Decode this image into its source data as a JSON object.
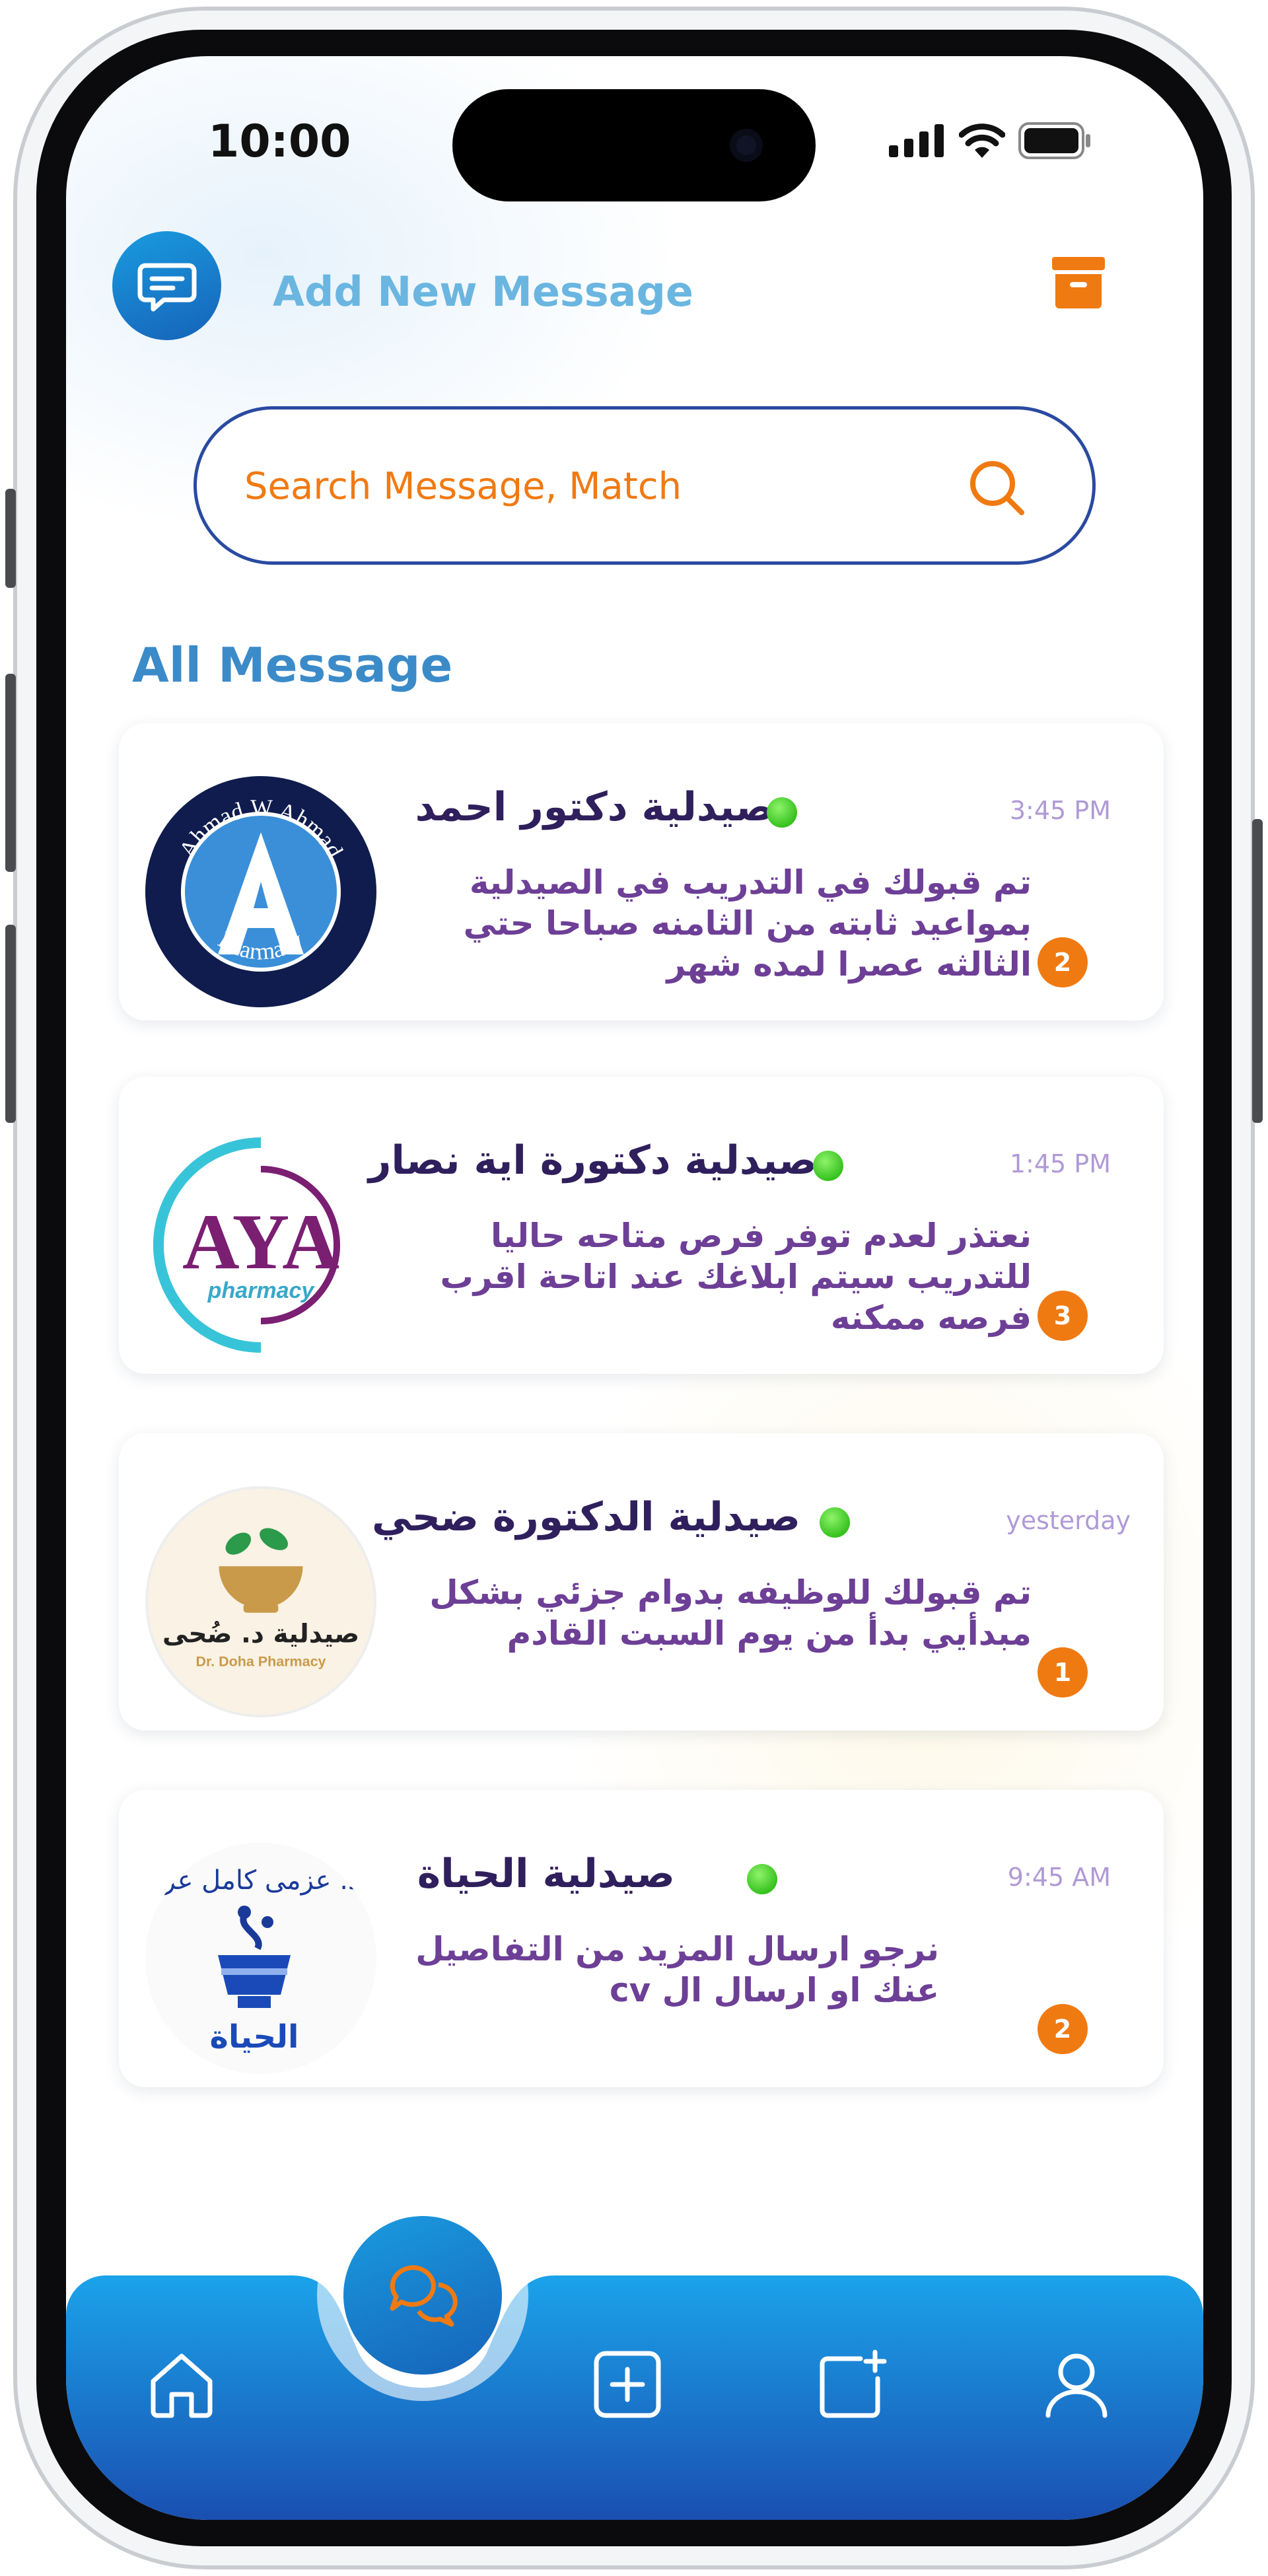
{
  "status_bar": {
    "time": "10:00"
  },
  "header": {
    "title": "Add New Message"
  },
  "search": {
    "placeholder": "Search Message, Match"
  },
  "section_title": "All Message",
  "conversations": [
    {
      "name": "صيدلية دكتور احمد",
      "time": "3:45 PM",
      "preview": "تم قبولك في التدريب في الصيدلية  بمواعيد ثابته من الثامنه صباحا حتي الثالثه عصرا لمده شهر",
      "unread": "2",
      "avatar_text": [
        "Ahmad W Ahmad",
        "A",
        "Pharmacy"
      ]
    },
    {
      "name": "صيدلية دكتورة اية نصار",
      "time": "1:45 PM",
      "preview": "نعتذر لعدم توفر فرص متاحه حاليا للتدريب سيتم ابلاغك عند اتاحة اقرب فرصه ممكنه",
      "unread": "3",
      "avatar_text": [
        "AYA",
        "pharmacy"
      ]
    },
    {
      "name": "صيدلية الدكتورة ضحي",
      "time": "yesterday",
      "preview": "تم قبولك للوظيفه بدوام جزئي بشكل مبدأيي بدأ من يوم السبت القادم",
      "unread": "1",
      "avatar_text": [
        "صيدلية د. ضُحى",
        "Dr. Doha Pharmacy"
      ]
    },
    {
      "name": "صيدلية الحياة",
      "time": "9:45 AM",
      "preview": "نرجو ارسال المزيد من التفاصيل عنك او ارسال ال cv",
      "unread": "2",
      "avatar_text": [
        "د. عزمى كامل عزى",
        "الحياة"
      ]
    }
  ],
  "colors": {
    "accent": "#f07a12",
    "primary": "#1a7fd0",
    "name": "#2f1f5c",
    "preview": "#6d3f96",
    "online": "#37c21f"
  },
  "nav": {
    "items": [
      "home-icon",
      "chat-icon",
      "add-square-icon",
      "new-post-icon",
      "profile-icon"
    ],
    "active": "chat-icon"
  }
}
